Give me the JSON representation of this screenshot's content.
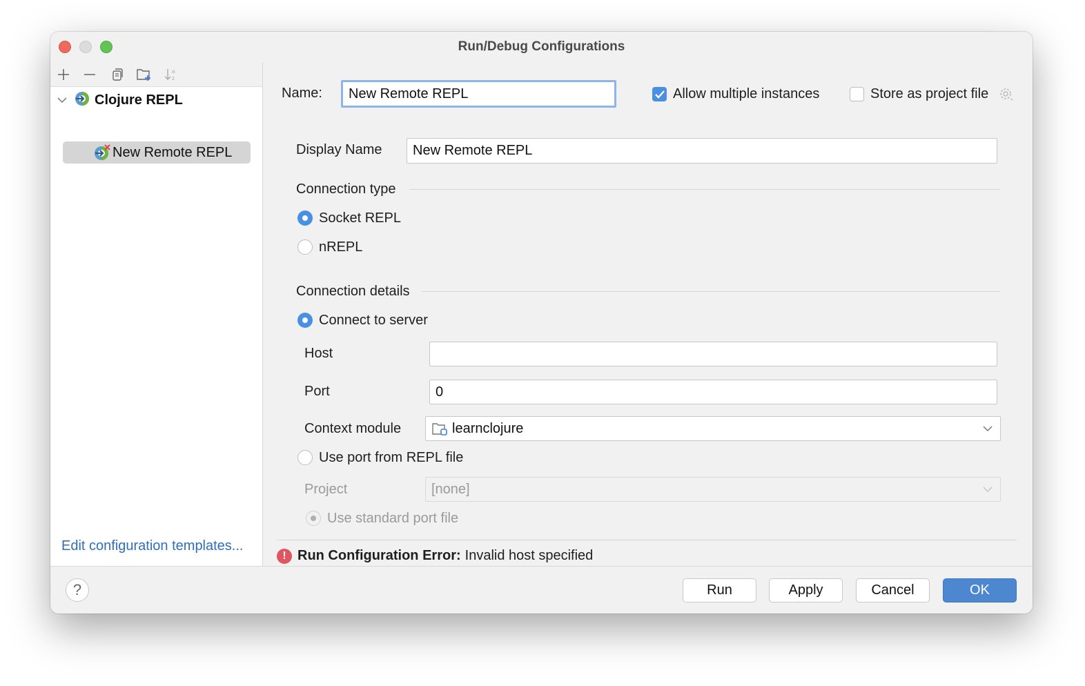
{
  "window": {
    "title": "Run/Debug Configurations"
  },
  "sidebar": {
    "toolbar": [
      {
        "name": "add-icon",
        "glyph": "+"
      },
      {
        "name": "remove-icon",
        "glyph": "—"
      },
      {
        "name": "copy-icon",
        "glyph": "copy"
      },
      {
        "name": "new-folder-icon",
        "glyph": "folder-plus"
      },
      {
        "name": "sort-icon",
        "glyph": "↓az"
      }
    ],
    "tree": {
      "parent": {
        "label": "Clojure REPL",
        "icon": "clojure-repl-icon",
        "expanded": true
      },
      "child": {
        "label": "New Remote REPL",
        "icon": "clojure-remote-error-icon",
        "selected": true
      }
    },
    "edit_templates_link": "Edit configuration templates..."
  },
  "form": {
    "name_label": "Name:",
    "name_value": "New Remote REPL",
    "allow_multiple": {
      "label": "Allow multiple instances",
      "checked": true
    },
    "store_project": {
      "label": "Store as project file",
      "checked": false
    },
    "display_name_label": "Display Name",
    "display_name_value": "New Remote REPL",
    "connection_type": {
      "title": "Connection type",
      "options": [
        {
          "label": "Socket REPL",
          "selected": true
        },
        {
          "label": "nREPL",
          "selected": false
        }
      ]
    },
    "connection_details": {
      "title": "Connection details",
      "connect_to_server": {
        "label": "Connect to server",
        "selected": true
      },
      "host_label": "Host",
      "host_value": "",
      "port_label": "Port",
      "port_value": "0",
      "context_module_label": "Context module",
      "context_module_value": "learnclojure",
      "use_port_file": {
        "label": "Use port from REPL file",
        "selected": false
      },
      "project_label": "Project",
      "project_value": "[none]",
      "use_standard_port_file": {
        "label": "Use standard port file",
        "selected": true,
        "disabled": true
      }
    }
  },
  "error": {
    "prefix": "Run Configuration Error:",
    "message": "Invalid host specified"
  },
  "footer": {
    "help": "?",
    "run": "Run",
    "apply": "Apply",
    "cancel": "Cancel",
    "ok": "OK"
  },
  "colors": {
    "accent": "#4a90e2",
    "primary_button": "#4c87cf",
    "link": "#2f6fb8",
    "error": "#e05561"
  }
}
